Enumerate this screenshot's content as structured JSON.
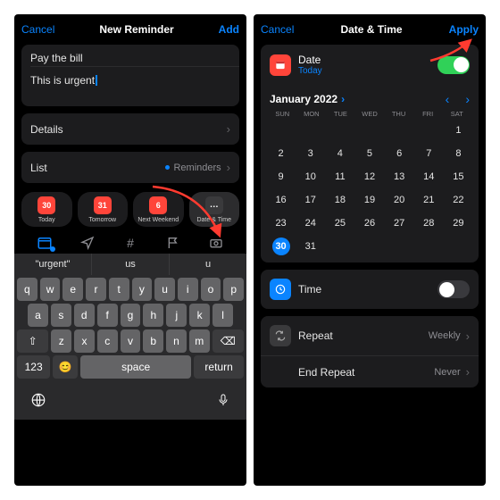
{
  "left": {
    "nav": {
      "cancel": "Cancel",
      "title": "New Reminder",
      "add": "Add"
    },
    "title_input": "Pay the bill",
    "notes_input": "This is urgent",
    "details_label": "Details",
    "list_label": "List",
    "list_value": "Reminders",
    "chips": [
      {
        "label": "Today",
        "badge": "30",
        "style": "red"
      },
      {
        "label": "Tomorrow",
        "badge": "31",
        "style": "red"
      },
      {
        "label": "Next Weekend",
        "badge": "6",
        "style": "red"
      },
      {
        "label": "Date & Time",
        "badge": "…",
        "style": "dark",
        "active": true
      }
    ],
    "suggestions": [
      "\"urgent\"",
      "us",
      "u"
    ],
    "keyboard": {
      "row1": [
        "q",
        "w",
        "e",
        "r",
        "t",
        "y",
        "u",
        "i",
        "o",
        "p"
      ],
      "row2": [
        "a",
        "s",
        "d",
        "f",
        "g",
        "h",
        "j",
        "k",
        "l"
      ],
      "row3_shift": "⇧",
      "row3": [
        "z",
        "x",
        "c",
        "v",
        "b",
        "n",
        "m"
      ],
      "row3_del": "⌫",
      "row4_123": "123",
      "row4_emoji": "😊",
      "row4_space": "space",
      "row4_return": "return"
    }
  },
  "right": {
    "nav": {
      "cancel": "Cancel",
      "title": "Date & Time",
      "apply": "Apply"
    },
    "date_label": "Date",
    "date_value": "Today",
    "month": "January 2022",
    "dow": [
      "SUN",
      "MON",
      "TUE",
      "WED",
      "THU",
      "FRI",
      "SAT"
    ],
    "days": [
      "",
      "",
      "",
      "",
      "",
      "",
      "1",
      "2",
      "3",
      "4",
      "5",
      "6",
      "7",
      "8",
      "9",
      "10",
      "11",
      "12",
      "13",
      "14",
      "15",
      "16",
      "17",
      "18",
      "19",
      "20",
      "21",
      "22",
      "23",
      "24",
      "25",
      "26",
      "27",
      "28",
      "29",
      "30",
      "31",
      "",
      "",
      "",
      "",
      ""
    ],
    "selected_day": "30",
    "time_label": "Time",
    "repeat_label": "Repeat",
    "repeat_value": "Weekly",
    "end_repeat_label": "End Repeat",
    "end_repeat_value": "Never"
  }
}
